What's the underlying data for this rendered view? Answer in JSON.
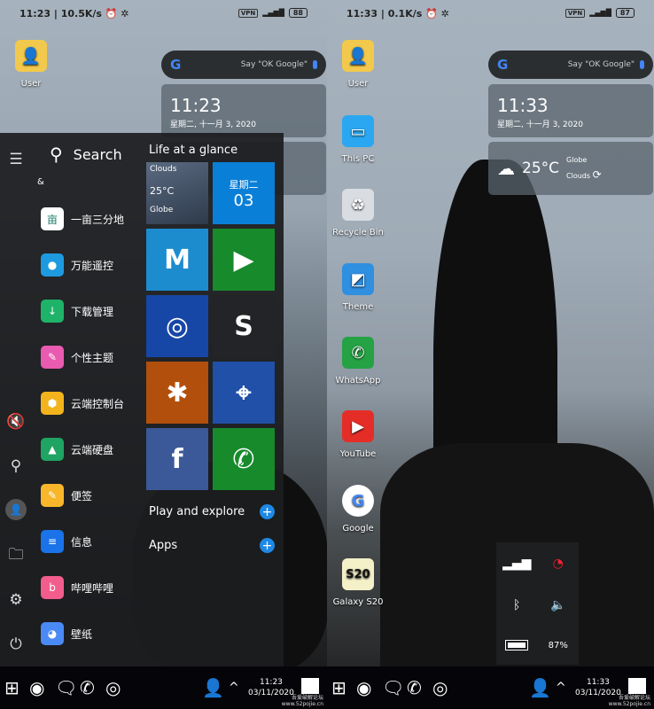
{
  "left": {
    "status": {
      "time": "11:23",
      "speed": "10.5K/s",
      "battery": "88"
    },
    "clock": {
      "time": "11:23",
      "date": "星期二, 十一月 3, 2020"
    },
    "desktop_icons": [
      {
        "label": "User",
        "icon": "user-folder-icon"
      }
    ],
    "start_menu": {
      "search_label": "Search",
      "group_header": "&",
      "glance_title": "Life at a glance",
      "apps": [
        {
          "label": "一亩三分地",
          "icon": "yimu-icon",
          "color": "#ffffff",
          "glyph": "亩"
        },
        {
          "label": "万能遥控",
          "icon": "remote-icon",
          "color": "#1e9be0",
          "glyph": "●"
        },
        {
          "label": "下载管理",
          "icon": "download-icon",
          "color": "#1fb36a",
          "glyph": "↓"
        },
        {
          "label": "个性主题",
          "icon": "theme-icon",
          "color": "#e95bb0",
          "glyph": "✎"
        },
        {
          "label": "云端控制台",
          "icon": "cloud-console-icon",
          "color": "#f3b31c",
          "glyph": "⬢"
        },
        {
          "label": "云端硬盘",
          "icon": "drive-icon",
          "color": "#1fa463",
          "glyph": "▲"
        },
        {
          "label": "便签",
          "icon": "notes-icon",
          "color": "#f8b62b",
          "glyph": "✎"
        },
        {
          "label": "信息",
          "icon": "messages-icon",
          "color": "#1a73e8",
          "glyph": "≡"
        },
        {
          "label": "哔哩哔哩",
          "icon": "bilibili-icon",
          "color": "#f25d8e",
          "glyph": "b"
        },
        {
          "label": "壁纸",
          "icon": "wallpaper-icon",
          "color": "#4a8af4",
          "glyph": "◕"
        }
      ],
      "tiles": [
        {
          "name": "weather",
          "color": "#3d4a5c",
          "condition": "Clouds",
          "temp": "25°C",
          "location": "Globe"
        },
        {
          "name": "calendar",
          "color": "#0a7fd8",
          "weekday": "星期二",
          "day": "03"
        },
        {
          "name": "gmail",
          "color": "#1c8ccf",
          "glyph": "M"
        },
        {
          "name": "play-store",
          "color": "#178a2b",
          "glyph": "▶"
        },
        {
          "name": "camera",
          "color": "#1747a6",
          "glyph": "◎"
        },
        {
          "name": "skype",
          "color": "#232427",
          "glyph": "S"
        },
        {
          "name": "photos",
          "color": "#b24f0c",
          "glyph": "✱"
        },
        {
          "name": "maps",
          "color": "#2050a8",
          "glyph": "⌖"
        },
        {
          "name": "facebook",
          "color": "#3b5998",
          "glyph": "f"
        },
        {
          "name": "whatsapp",
          "color": "#178a2b",
          "glyph": "✆"
        }
      ],
      "sections": [
        "Play and explore",
        "Apps"
      ]
    },
    "taskbar": {
      "time": "11:23",
      "date": "03/11/2020"
    }
  },
  "right": {
    "status": {
      "time": "11:33",
      "speed": "0.1K/s",
      "battery": "87"
    },
    "clock": {
      "time": "11:33",
      "date": "星期二, 十一月 3, 2020"
    },
    "weather": {
      "temp": "25°C",
      "location": "Globe",
      "condition": "Clouds"
    },
    "desktop_icons": [
      {
        "label": "User",
        "icon": "user-folder-icon",
        "color": "#f2c94c",
        "glyph": "👤"
      },
      {
        "label": "This PC",
        "icon": "this-pc-icon",
        "color": "#2aa7f0",
        "glyph": "▭"
      },
      {
        "label": "Recycle Bin",
        "icon": "recycle-bin-icon",
        "color": "#d9dde2",
        "glyph": "♻"
      },
      {
        "label": "Theme",
        "icon": "theme-icon",
        "color": "#2f8fe0",
        "glyph": "◩"
      },
      {
        "label": "WhatsApp",
        "icon": "whatsapp-icon",
        "color": "#25a244",
        "glyph": "✆"
      },
      {
        "label": "YouTube",
        "icon": "youtube-icon",
        "color": "#e52d27",
        "glyph": "▶"
      },
      {
        "label": "Google",
        "icon": "google-icon",
        "color": "#ffffff",
        "glyph": "G"
      },
      {
        "label": "Galaxy S20",
        "icon": "galaxy-s20-icon",
        "color": "#f4f0c8",
        "glyph": "S20"
      }
    ],
    "quick_panel": {
      "battery": "87%"
    },
    "taskbar": {
      "time": "11:33",
      "date": "03/11/2020"
    }
  },
  "common": {
    "google_hint": "Say \"OK Google\"",
    "google_logo": "G",
    "watermark_1": "吾爱破解论坛",
    "watermark_2": "www.52pojie.cn",
    "vpn": "VPN"
  }
}
